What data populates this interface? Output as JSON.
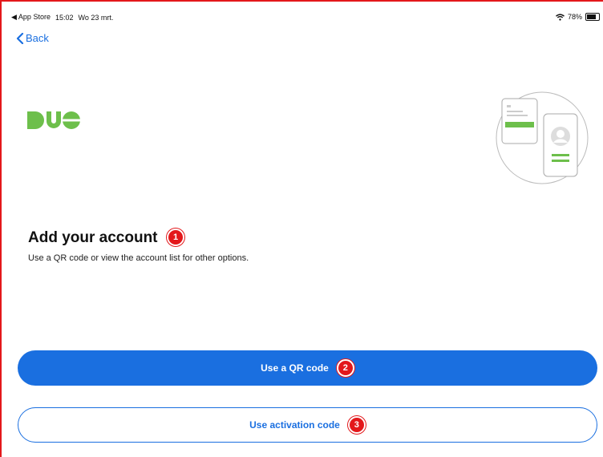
{
  "status_bar": {
    "back_app": "◀ App Store",
    "time": "15:02",
    "date": "Wo 23 mrt.",
    "battery": "78%",
    "battery_level": 0.78
  },
  "nav": {
    "back_label": "Back"
  },
  "brand": {
    "logo_text": "DUO",
    "accent": "#6dbf4b"
  },
  "content": {
    "title": "Add your account",
    "subtitle": "Use a QR code or view the account list for other options."
  },
  "buttons": {
    "qr_label": "Use a QR code",
    "activation_label": "Use activation code"
  },
  "badges": {
    "b1": "1",
    "b2": "2",
    "b3": "3"
  },
  "colors": {
    "primary": "#1a6fe0",
    "badge": "#e3181b",
    "logo": "#6dbf4b"
  }
}
